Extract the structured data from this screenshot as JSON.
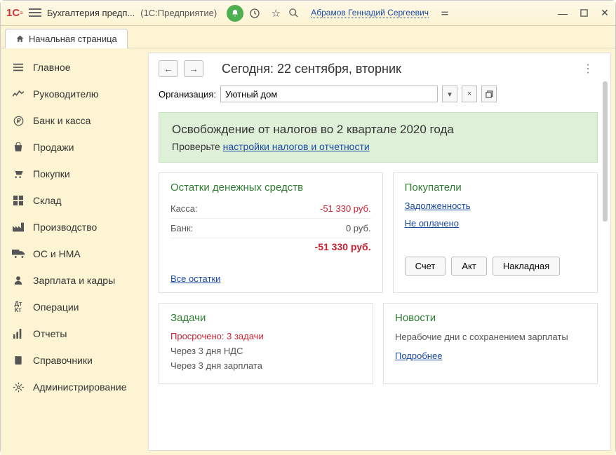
{
  "titlebar": {
    "app_title": "Бухгалтерия предп...",
    "app_sub": "(1С:Предприятие)",
    "user": "Абрамов Геннадий Сергеевич"
  },
  "tab": {
    "label": "Начальная страница"
  },
  "sidebar": {
    "items": [
      {
        "label": "Главное"
      },
      {
        "label": "Руководителю"
      },
      {
        "label": "Банк и касса"
      },
      {
        "label": "Продажи"
      },
      {
        "label": "Покупки"
      },
      {
        "label": "Склад"
      },
      {
        "label": "Производство"
      },
      {
        "label": "ОС и НМА"
      },
      {
        "label": "Зарплата и кадры"
      },
      {
        "label": "Операции"
      },
      {
        "label": "Отчеты"
      },
      {
        "label": "Справочники"
      },
      {
        "label": "Администрирование"
      }
    ]
  },
  "main": {
    "title": "Сегодня: 22 сентября, вторник",
    "org_label": "Организация:",
    "org_value": "Уютный дом"
  },
  "banner": {
    "title": "Освобождение от налогов во 2 квартале 2020 года",
    "prefix": "Проверьте ",
    "link": "настройки налогов и отчетности"
  },
  "cash": {
    "title": "Остатки денежных средств",
    "rows": [
      {
        "label": "Касса:",
        "value": "-51 330 руб.",
        "neg": true
      },
      {
        "label": "Банк:",
        "value": "0 руб.",
        "neg": false
      }
    ],
    "total": "-51 330 руб.",
    "all_link": "Все остатки"
  },
  "buyers": {
    "title": "Покупатели",
    "link1": "Задолженность",
    "link2": "Не оплачено",
    "btn1": "Счет",
    "btn2": "Акт",
    "btn3": "Накладная"
  },
  "tasks": {
    "title": "Задачи",
    "overdue": "Просрочено: 3 задачи",
    "line1": "Через 3 дня НДС",
    "line2": "Через 3 дня зарплата"
  },
  "news": {
    "title": "Новости",
    "text": "Нерабочие дни с сохранением зарплаты",
    "more": "Подробнее"
  }
}
